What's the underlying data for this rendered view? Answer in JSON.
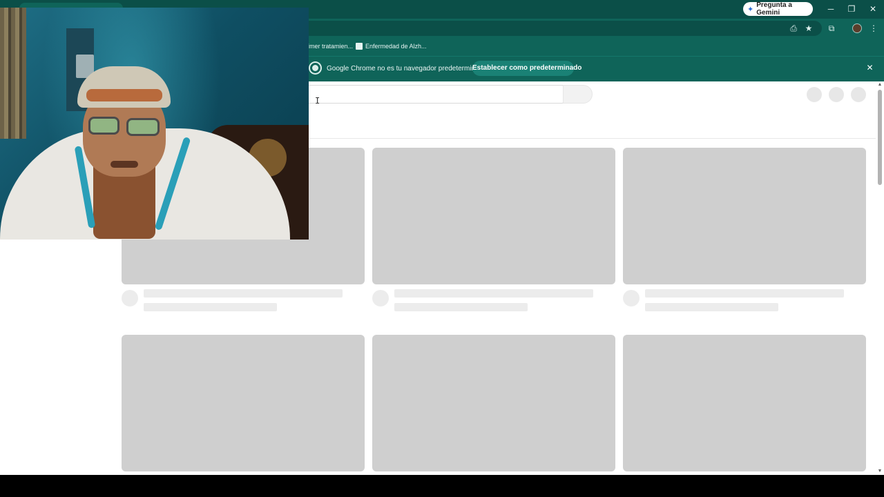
{
  "browser": {
    "tab_title": "...",
    "gemini_button_label": "Pregunta a Gemini",
    "window_controls": {
      "minimize": "─",
      "restore": "❐",
      "close": "✕"
    },
    "toolbar_icons": [
      "install-app-icon",
      "bookmark-star-icon",
      "extensions-icon",
      "profile-avatar",
      "menu-icon"
    ]
  },
  "bookmarks": [
    {
      "label": "imer tratamien..."
    },
    {
      "label": "Enfermedad de Alzh..."
    }
  ],
  "infobar": {
    "message": "Google Chrome no es tu navegador predeterminado",
    "action_label": "Establecer como predeterminado",
    "close_glyph": "✕"
  },
  "page": {
    "state": "loading skeleton",
    "cursor_glyph": "I"
  },
  "colors": {
    "chrome_frame": "#0f6459",
    "chrome_titlebar": "#0b4f48",
    "skeleton_card": "#cfcfcf",
    "skeleton_line": "#ececec"
  }
}
